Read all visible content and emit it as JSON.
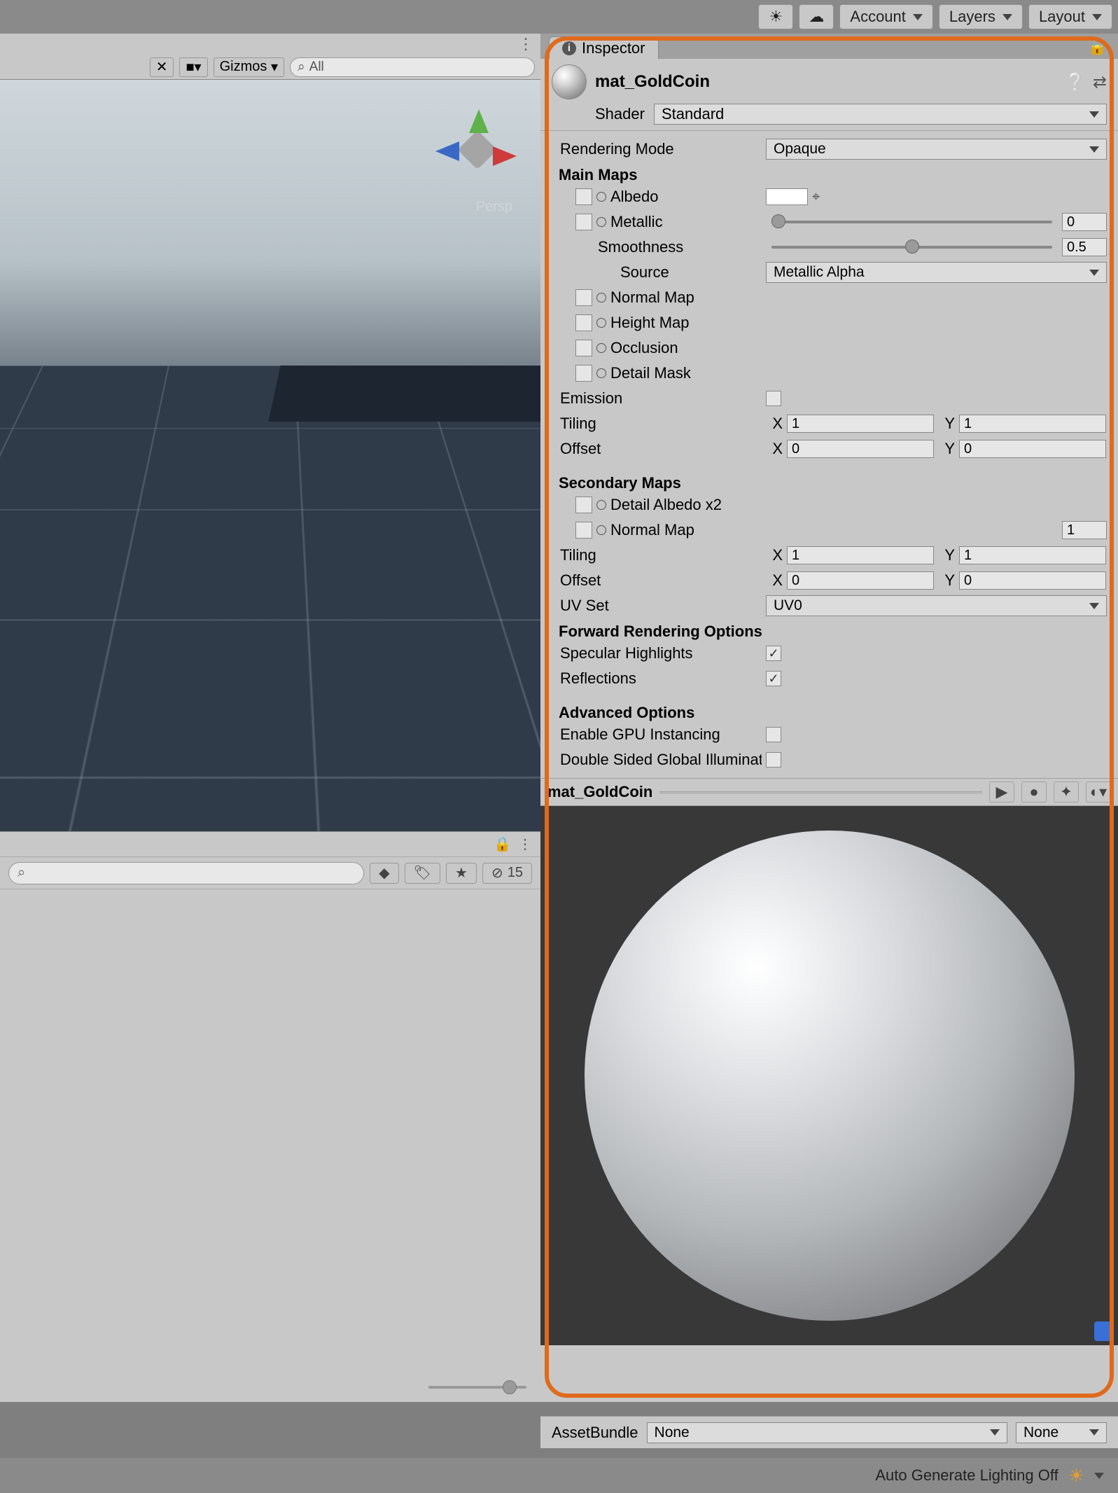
{
  "topbar": {
    "account": "Account",
    "layers": "Layers",
    "layout": "Layout"
  },
  "scene": {
    "gizmos": "Gizmos",
    "search_placeholder": "All",
    "persp_label": "Persp"
  },
  "project": {
    "hidden_count": "15"
  },
  "inspector": {
    "tab_title": "Inspector",
    "material_name": "mat_GoldCoin",
    "shader_label": "Shader",
    "shader_value": "Standard",
    "rendering_mode_label": "Rendering Mode",
    "rendering_mode_value": "Opaque",
    "main_maps": "Main Maps",
    "albedo": "Albedo",
    "metallic": "Metallic",
    "metallic_value": "0",
    "smoothness": "Smoothness",
    "smoothness_value": "0.5",
    "source": "Source",
    "source_value": "Metallic Alpha",
    "normal_map": "Normal Map",
    "height_map": "Height Map",
    "occlusion": "Occlusion",
    "detail_mask": "Detail Mask",
    "emission": "Emission",
    "tiling": "Tiling",
    "tiling_x": "1",
    "tiling_y": "1",
    "offset": "Offset",
    "offset_x": "0",
    "offset_y": "0",
    "secondary_maps": "Secondary Maps",
    "detail_albedo": "Detail Albedo x2",
    "normal_map2": "Normal Map",
    "normal_map2_value": "1",
    "tiling2_x": "1",
    "tiling2_y": "1",
    "offset2_x": "0",
    "offset2_y": "0",
    "uv_set": "UV Set",
    "uv_set_value": "UV0",
    "forward_opts": "Forward Rendering Options",
    "specular_highlights": "Specular Highlights",
    "reflections": "Reflections",
    "advanced_opts": "Advanced Options",
    "gpu_instancing": "Enable GPU Instancing",
    "double_sided_gi": "Double Sided Global Illuminati",
    "preview_name": "mat_GoldCoin"
  },
  "assetbar": {
    "label": "AssetBundle",
    "bundle": "None",
    "variant": "None"
  },
  "statusbar": {
    "lighting": "Auto Generate Lighting Off"
  },
  "xy": {
    "x": "X",
    "y": "Y"
  }
}
